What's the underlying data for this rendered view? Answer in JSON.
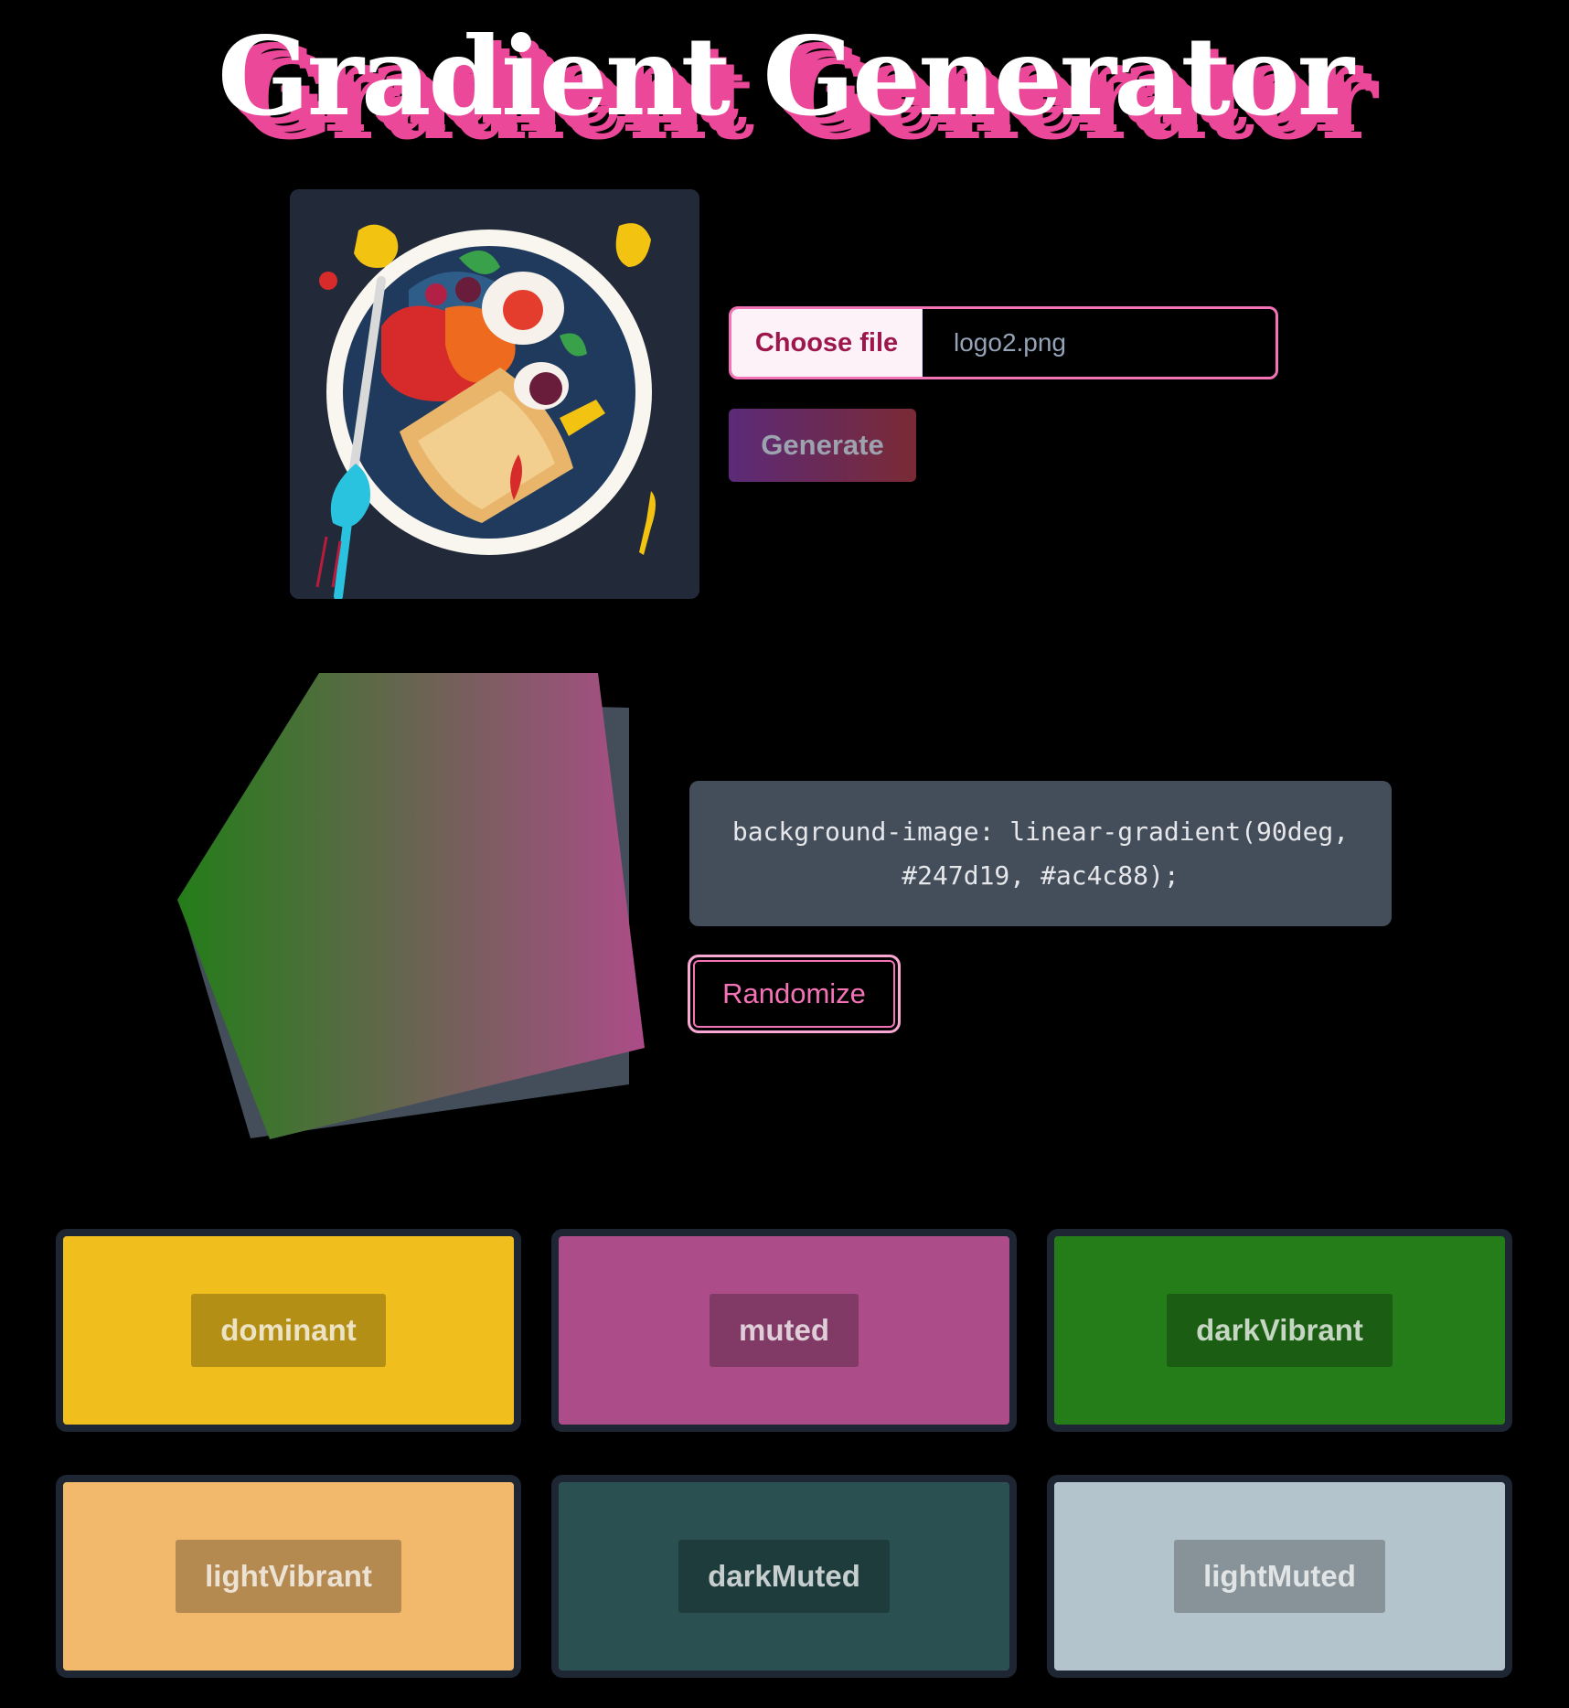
{
  "app": {
    "title": "Gradient Generator"
  },
  "upload": {
    "choose_label": "Choose file",
    "file_name": "logo2.png",
    "generate_label": "Generate"
  },
  "gradient": {
    "css_line1": "background-image: linear-gradient(90deg,",
    "css_line2": "#247d19, #ac4c88);",
    "angle": "90deg",
    "color_start": "#247d19",
    "color_end": "#ac4c88",
    "randomize_label": "Randomize"
  },
  "palette": [
    {
      "name": "dominant",
      "color": "#f0bf1e"
    },
    {
      "name": "muted",
      "color": "#ac4c88"
    },
    {
      "name": "darkVibrant",
      "color": "#247d19"
    },
    {
      "name": "lightVibrant",
      "color": "#f2b96c"
    },
    {
      "name": "darkMuted",
      "color": "#2a5052"
    },
    {
      "name": "lightMuted",
      "color": "#b4c4cc"
    }
  ],
  "colors": {
    "accent": "#ec4899",
    "panel": "#444d5a",
    "card_border": "#1e2533"
  }
}
